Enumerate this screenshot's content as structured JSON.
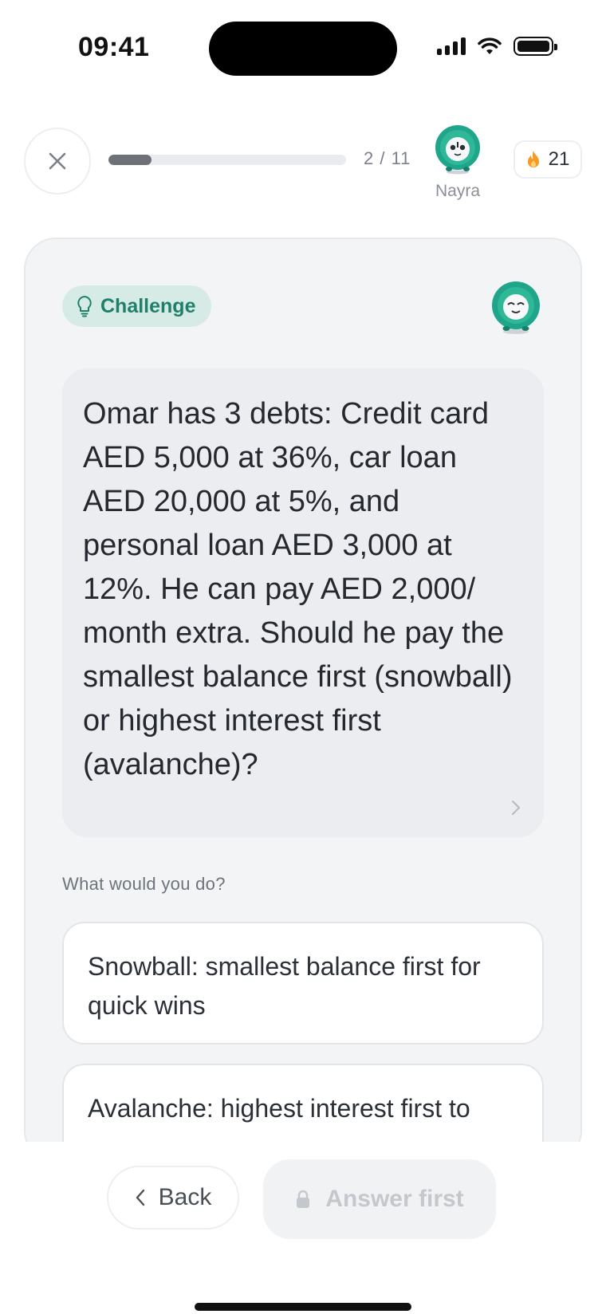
{
  "status_bar": {
    "time": "09:41"
  },
  "lesson_header": {
    "progress_label": "2 / 11",
    "progress_fraction": 0.18,
    "mascot_name": "Nayra",
    "streak_count": "21",
    "close_icon": "close-icon",
    "streak_icon": "flame-icon"
  },
  "card": {
    "badge_label": "Challenge",
    "badge_icon": "lightbulb-icon",
    "question": "Omar has 3 debts: Credit card AED 5,000 at 36%, car loan AED 20,000 at 5%, and personal loan AED 3,000 at 12%. He can pay AED 2,000/ month extra. Should he pay the smallest balance first (snowball) or highest interest first (avalanche)?",
    "prompt": "What would you do?",
    "options": [
      {
        "label": "Snowball: smallest balance first for quick wins"
      },
      {
        "label": "Avalanche: highest interest first to"
      }
    ]
  },
  "actions": {
    "back_label": "Back",
    "answer_label": "Answer first",
    "answer_icon": "lock-icon"
  },
  "colors": {
    "accent": "#1f7f6b",
    "badge_bg": "#d7ebe6",
    "flame": "#f59a23",
    "mascot": "#1fa58a"
  }
}
